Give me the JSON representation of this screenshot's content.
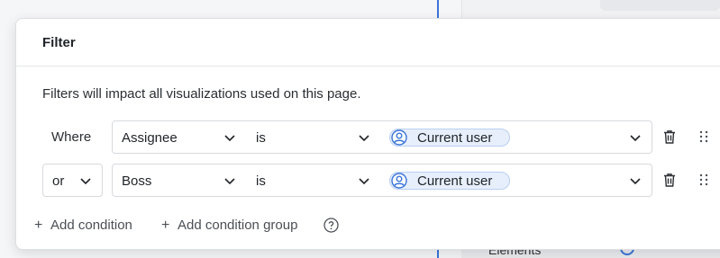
{
  "background": {
    "row_label": "Elements"
  },
  "filter": {
    "title": "Filter",
    "description": "Filters will impact all visualizations used on this page.",
    "rows": [
      {
        "connector": "Where",
        "field": "Assignee",
        "operator": "is",
        "value": "Current user"
      },
      {
        "connector": "or",
        "field": "Boss",
        "operator": "is",
        "value": "Current user"
      }
    ],
    "add_condition_label": "Add condition",
    "add_group_label": "Add condition group"
  },
  "icons": {
    "chevron": "chevron-down-icon",
    "user": "user-icon",
    "delete": "trash-icon",
    "drag": "drag-handle-icon",
    "help": "help-icon",
    "add": "plus-icon"
  },
  "colors": {
    "accent": "#3b74d8",
    "chip_bg": "#e7effc"
  }
}
